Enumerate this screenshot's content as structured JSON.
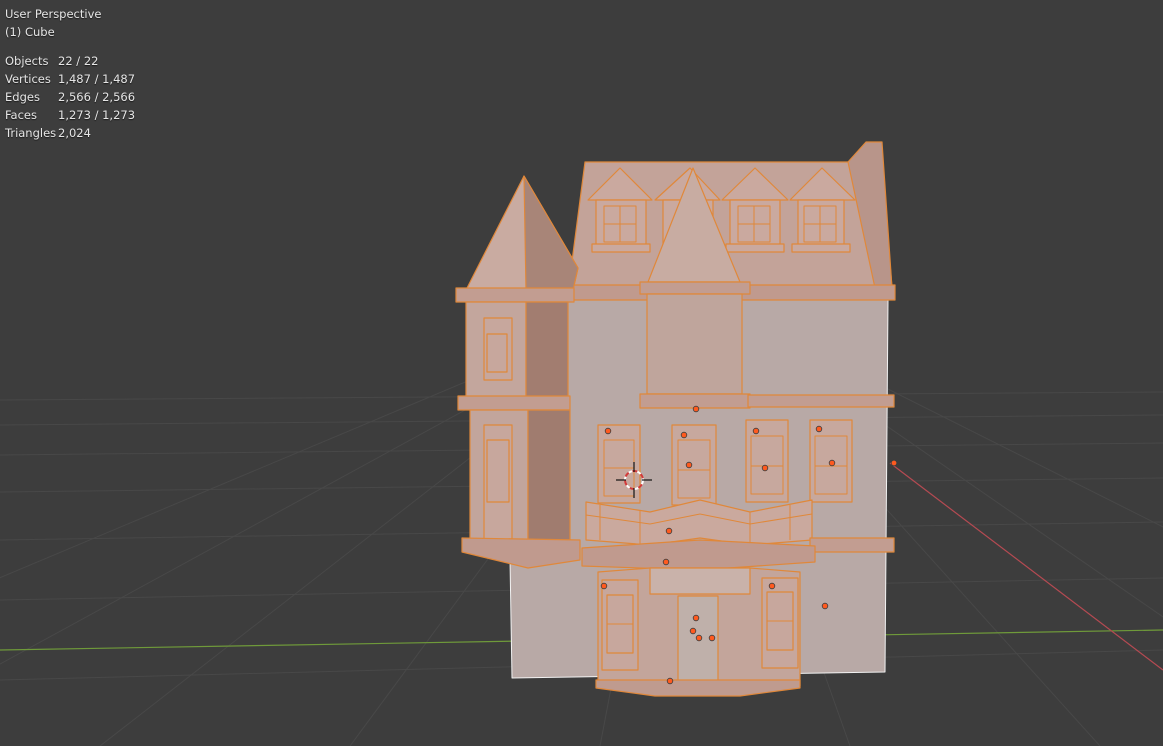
{
  "viewport": {
    "view_name": "User Perspective",
    "active_object": "(1) Cube",
    "selection_color": "#e0883a",
    "x_axis_color": "#b54a52",
    "y_axis_color": "#6f9a3a",
    "background_color": "#3d3d3d"
  },
  "stats": [
    {
      "label": "Objects",
      "value": "22 / 22"
    },
    {
      "label": "Vertices",
      "value": "1,487 / 1,487"
    },
    {
      "label": "Edges",
      "value": "2,566 / 2,566"
    },
    {
      "label": "Faces",
      "value": "1,273 / 1,273"
    },
    {
      "label": "Triangles",
      "value": "2,024"
    }
  ],
  "icons": {
    "cursor": "3d-cursor-icon",
    "origin": "object-origin-icon"
  }
}
